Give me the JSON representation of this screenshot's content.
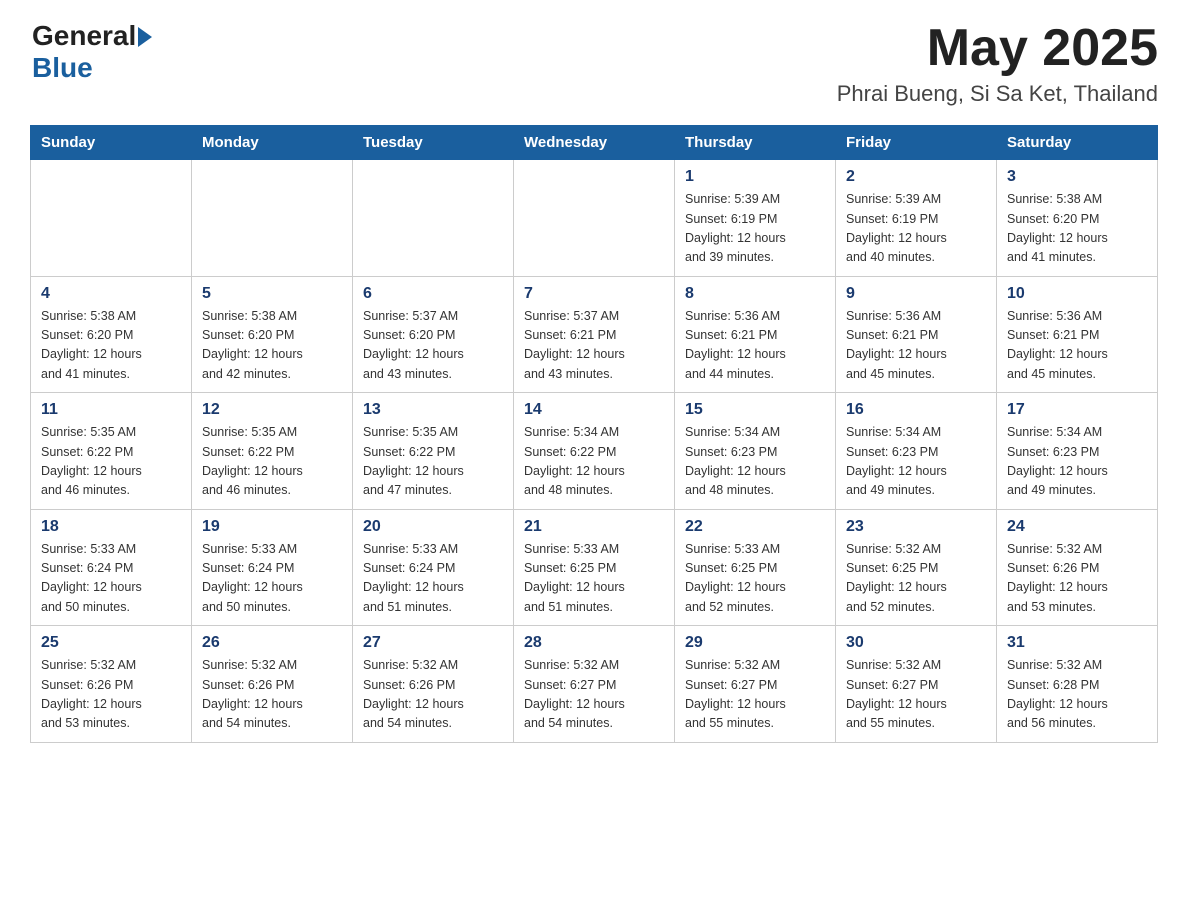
{
  "header": {
    "logo": {
      "general": "General",
      "blue": "Blue",
      "arrow": "►"
    },
    "month_title": "May 2025",
    "location": "Phrai Bueng, Si Sa Ket, Thailand"
  },
  "calendar": {
    "days_of_week": [
      "Sunday",
      "Monday",
      "Tuesday",
      "Wednesday",
      "Thursday",
      "Friday",
      "Saturday"
    ],
    "weeks": [
      [
        {
          "day": "",
          "info": ""
        },
        {
          "day": "",
          "info": ""
        },
        {
          "day": "",
          "info": ""
        },
        {
          "day": "",
          "info": ""
        },
        {
          "day": "1",
          "info": "Sunrise: 5:39 AM\nSunset: 6:19 PM\nDaylight: 12 hours\nand 39 minutes."
        },
        {
          "day": "2",
          "info": "Sunrise: 5:39 AM\nSunset: 6:19 PM\nDaylight: 12 hours\nand 40 minutes."
        },
        {
          "day": "3",
          "info": "Sunrise: 5:38 AM\nSunset: 6:20 PM\nDaylight: 12 hours\nand 41 minutes."
        }
      ],
      [
        {
          "day": "4",
          "info": "Sunrise: 5:38 AM\nSunset: 6:20 PM\nDaylight: 12 hours\nand 41 minutes."
        },
        {
          "day": "5",
          "info": "Sunrise: 5:38 AM\nSunset: 6:20 PM\nDaylight: 12 hours\nand 42 minutes."
        },
        {
          "day": "6",
          "info": "Sunrise: 5:37 AM\nSunset: 6:20 PM\nDaylight: 12 hours\nand 43 minutes."
        },
        {
          "day": "7",
          "info": "Sunrise: 5:37 AM\nSunset: 6:21 PM\nDaylight: 12 hours\nand 43 minutes."
        },
        {
          "day": "8",
          "info": "Sunrise: 5:36 AM\nSunset: 6:21 PM\nDaylight: 12 hours\nand 44 minutes."
        },
        {
          "day": "9",
          "info": "Sunrise: 5:36 AM\nSunset: 6:21 PM\nDaylight: 12 hours\nand 45 minutes."
        },
        {
          "day": "10",
          "info": "Sunrise: 5:36 AM\nSunset: 6:21 PM\nDaylight: 12 hours\nand 45 minutes."
        }
      ],
      [
        {
          "day": "11",
          "info": "Sunrise: 5:35 AM\nSunset: 6:22 PM\nDaylight: 12 hours\nand 46 minutes."
        },
        {
          "day": "12",
          "info": "Sunrise: 5:35 AM\nSunset: 6:22 PM\nDaylight: 12 hours\nand 46 minutes."
        },
        {
          "day": "13",
          "info": "Sunrise: 5:35 AM\nSunset: 6:22 PM\nDaylight: 12 hours\nand 47 minutes."
        },
        {
          "day": "14",
          "info": "Sunrise: 5:34 AM\nSunset: 6:22 PM\nDaylight: 12 hours\nand 48 minutes."
        },
        {
          "day": "15",
          "info": "Sunrise: 5:34 AM\nSunset: 6:23 PM\nDaylight: 12 hours\nand 48 minutes."
        },
        {
          "day": "16",
          "info": "Sunrise: 5:34 AM\nSunset: 6:23 PM\nDaylight: 12 hours\nand 49 minutes."
        },
        {
          "day": "17",
          "info": "Sunrise: 5:34 AM\nSunset: 6:23 PM\nDaylight: 12 hours\nand 49 minutes."
        }
      ],
      [
        {
          "day": "18",
          "info": "Sunrise: 5:33 AM\nSunset: 6:24 PM\nDaylight: 12 hours\nand 50 minutes."
        },
        {
          "day": "19",
          "info": "Sunrise: 5:33 AM\nSunset: 6:24 PM\nDaylight: 12 hours\nand 50 minutes."
        },
        {
          "day": "20",
          "info": "Sunrise: 5:33 AM\nSunset: 6:24 PM\nDaylight: 12 hours\nand 51 minutes."
        },
        {
          "day": "21",
          "info": "Sunrise: 5:33 AM\nSunset: 6:25 PM\nDaylight: 12 hours\nand 51 minutes."
        },
        {
          "day": "22",
          "info": "Sunrise: 5:33 AM\nSunset: 6:25 PM\nDaylight: 12 hours\nand 52 minutes."
        },
        {
          "day": "23",
          "info": "Sunrise: 5:32 AM\nSunset: 6:25 PM\nDaylight: 12 hours\nand 52 minutes."
        },
        {
          "day": "24",
          "info": "Sunrise: 5:32 AM\nSunset: 6:26 PM\nDaylight: 12 hours\nand 53 minutes."
        }
      ],
      [
        {
          "day": "25",
          "info": "Sunrise: 5:32 AM\nSunset: 6:26 PM\nDaylight: 12 hours\nand 53 minutes."
        },
        {
          "day": "26",
          "info": "Sunrise: 5:32 AM\nSunset: 6:26 PM\nDaylight: 12 hours\nand 54 minutes."
        },
        {
          "day": "27",
          "info": "Sunrise: 5:32 AM\nSunset: 6:26 PM\nDaylight: 12 hours\nand 54 minutes."
        },
        {
          "day": "28",
          "info": "Sunrise: 5:32 AM\nSunset: 6:27 PM\nDaylight: 12 hours\nand 54 minutes."
        },
        {
          "day": "29",
          "info": "Sunrise: 5:32 AM\nSunset: 6:27 PM\nDaylight: 12 hours\nand 55 minutes."
        },
        {
          "day": "30",
          "info": "Sunrise: 5:32 AM\nSunset: 6:27 PM\nDaylight: 12 hours\nand 55 minutes."
        },
        {
          "day": "31",
          "info": "Sunrise: 5:32 AM\nSunset: 6:28 PM\nDaylight: 12 hours\nand 56 minutes."
        }
      ]
    ]
  }
}
